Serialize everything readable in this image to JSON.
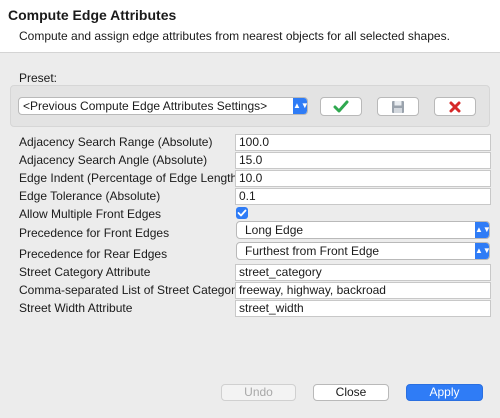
{
  "dialog": {
    "title": "Compute Edge Attributes",
    "description": "Compute and assign edge attributes from nearest objects for all selected shapes."
  },
  "preset": {
    "label": "Preset:",
    "selected": "<Previous Compute Edge Attributes Settings>",
    "icons": [
      "apply-check-icon",
      "save-disk-icon",
      "delete-x-icon"
    ]
  },
  "fields": {
    "adjacency_range": {
      "label": "Adjacency Search Range (Absolute)",
      "value": "100.0"
    },
    "adjacency_angle": {
      "label": "Adjacency Search Angle (Absolute)",
      "value": "15.0"
    },
    "edge_indent": {
      "label": "Edge Indent (Percentage of Edge Length)",
      "value": "10.0"
    },
    "edge_tolerance": {
      "label": "Edge Tolerance (Absolute)",
      "value": "0.1"
    },
    "multiple_front": {
      "label": "Allow Multiple Front Edges",
      "checked": true
    },
    "precedence_front": {
      "label": "Precedence for Front Edges",
      "value": "Long Edge"
    },
    "precedence_rear": {
      "label": "Precedence for Rear Edges",
      "value": "Furthest from Front Edge"
    },
    "street_category_attr": {
      "label": "Street Category Attribute",
      "value": "street_category"
    },
    "street_categories": {
      "label": "Comma-separated List of Street Categories",
      "value": "freeway, highway, backroad"
    },
    "street_width_attr": {
      "label": "Street Width Attribute",
      "value": "street_width"
    }
  },
  "buttons": {
    "undo": "Undo",
    "close": "Close",
    "apply": "Apply"
  },
  "colors": {
    "accent": "#2f7cf6",
    "check_green": "#2fa84f",
    "delete_red": "#d62828",
    "disabled_text": "#a8a8a8"
  }
}
